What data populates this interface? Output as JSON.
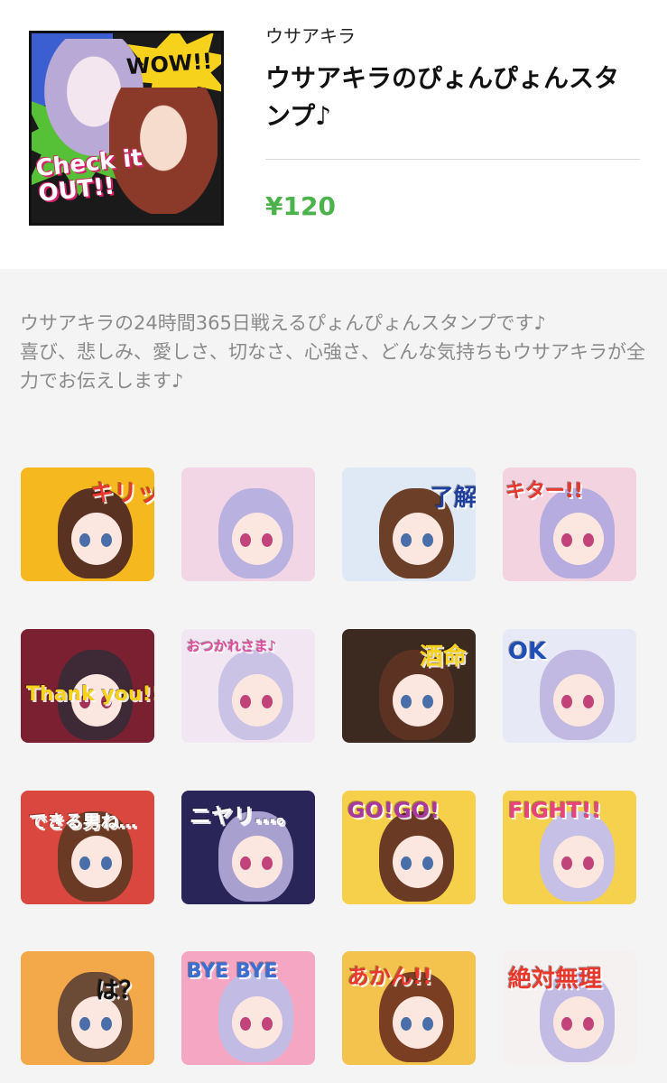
{
  "product": {
    "author": "ウサアキラ",
    "title": "ウサアキラのぴょんぴょんスタンプ♪",
    "price": "¥120",
    "thumbnail_texts": {
      "wow": "WOW!!",
      "check_line1": "Check it",
      "check_line2": "OUT!!"
    }
  },
  "description": {
    "line1": "ウサアキラの24時間365日戦えるぴょんぴょんスタンプです♪",
    "line2": "喜び、悲しみ、愛しさ、切なさ、心強さ、どんな気持ちもウサアキラが全力でお伝えします♪"
  },
  "stickers": [
    {
      "caption": "キリッ",
      "bg": "#f6b81f",
      "hair": "#5a3222",
      "eye": "#4a6ea8",
      "cap_color": "#e8382b"
    },
    {
      "caption": "",
      "bg": "#f3d6e6",
      "hair": "#b9b2e0",
      "eye": "#c2437a",
      "cap_color": "#e14b6e"
    },
    {
      "caption": "了解♪",
      "bg": "#dfe9f6",
      "hair": "#6b3f28",
      "eye": "#4a6ea8",
      "cap_color": "#1e3f9c"
    },
    {
      "caption": "キター!!",
      "bg": "#f4d3e0",
      "hair": "#b6acdf",
      "eye": "#c2437a",
      "cap_color": "#e8382b"
    },
    {
      "caption": "Thank you!!",
      "bg": "#7b2030",
      "hair": "#3d2a36",
      "eye": "#a0325a",
      "cap_color": "#f7d21c"
    },
    {
      "caption": "おつかれさま♪",
      "bg": "#f1e6f2",
      "hair": "#cbc3e6",
      "eye": "#c2437a",
      "cap_color": "#e14b9e"
    },
    {
      "caption": "酒命",
      "bg": "#3c2a20",
      "hair": "#5c3322",
      "eye": "#4a6ea8",
      "cap_color": "#f7d21c"
    },
    {
      "caption": "OK",
      "bg": "#e7e9f6",
      "hair": "#c1b9e2",
      "eye": "#c2437a",
      "cap_color": "#1f4fb4"
    },
    {
      "caption": "できる男ね…",
      "bg": "#d9473f",
      "hair": "#6b3a24",
      "eye": "#4a6ea8",
      "cap_color": "#ffffff"
    },
    {
      "caption": "ニヤリ…。",
      "bg": "#2a2558",
      "hair": "#a8a1d0",
      "eye": "#c2437a",
      "cap_color": "#ffffff"
    },
    {
      "caption": "GO!GO!",
      "bg": "#f6d04a",
      "hair": "#6b3a24",
      "eye": "#4a6ea8",
      "cap_color": "#a9389e"
    },
    {
      "caption": "FIGHT!!",
      "bg": "#f5d14e",
      "hair": "#c7c0e6",
      "eye": "#c2437a",
      "cap_color": "#e8447c"
    },
    {
      "caption": "は？",
      "bg": "#f3a94a",
      "hair": "#6b4a36",
      "eye": "#4a6ea8",
      "cap_color": "#111111"
    },
    {
      "caption": "BYE BYE",
      "bg": "#f5a6c3",
      "hair": "#c2bbe4",
      "eye": "#c2437a",
      "cap_color": "#3a6fd1"
    },
    {
      "caption": "あかん!!",
      "bg": "#f3c34e",
      "hair": "#7a3e22",
      "eye": "#4a6ea8",
      "cap_color": "#e8382b"
    },
    {
      "caption": "絶対無理",
      "bg": "#f6f1f1",
      "hair": "#c2bbe4",
      "eye": "#c2437a",
      "cap_color": "#e8382b"
    }
  ]
}
